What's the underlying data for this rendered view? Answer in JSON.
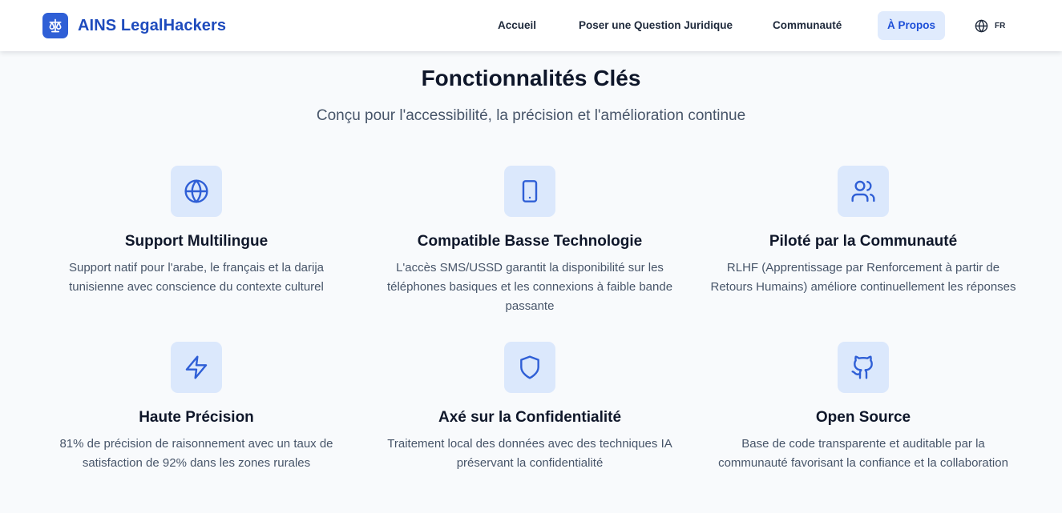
{
  "header": {
    "brand": {
      "name": "AINS LegalHackers",
      "icon": "scale-icon"
    },
    "nav": [
      {
        "label": "Accueil",
        "active": false
      },
      {
        "label": "Poser une Question Juridique",
        "active": false
      },
      {
        "label": "Communauté",
        "active": false
      },
      {
        "label": "À Propos",
        "active": true
      }
    ],
    "language": {
      "icon": "globe-icon",
      "code": "FR"
    }
  },
  "features": {
    "title": "Fonctionnalités Clés",
    "subtitle": "Conçu pour l'accessibilité, la précision et l'amélioration continue",
    "items": [
      {
        "icon": "globe-icon",
        "title": "Support Multilingue",
        "description": "Support natif pour l'arabe, le français et la darija tunisienne avec conscience du contexte culturel"
      },
      {
        "icon": "tablet-icon",
        "title": "Compatible Basse Technologie",
        "description": "L'accès SMS/USSD garantit la disponibilité sur les téléphones basiques et les connexions à faible bande passante"
      },
      {
        "icon": "users-icon",
        "title": "Piloté par la Communauté",
        "description": "RLHF (Apprentissage par Renforcement à partir de Retours Humains) améliore continuellement les réponses"
      },
      {
        "icon": "lightning-icon",
        "title": "Haute Précision",
        "description": "81% de précision de raisonnement avec un taux de satisfaction de 92% dans les zones rurales"
      },
      {
        "icon": "shield-icon",
        "title": "Axé sur la Confidentialité",
        "description": "Traitement local des données avec des techniques IA préservant la confidentialité"
      },
      {
        "icon": "github-icon",
        "title": "Open Source",
        "description": "Base de code transparente et auditable par la communauté favorisant la confiance et la collaboration"
      }
    ]
  },
  "colors": {
    "accent": "#2f5fd6",
    "brand_text": "#1e4bbd",
    "icon_bg": "#dbe8fc",
    "active_nav_bg": "#e0ebfd",
    "page_bg": "#f8fafc"
  }
}
